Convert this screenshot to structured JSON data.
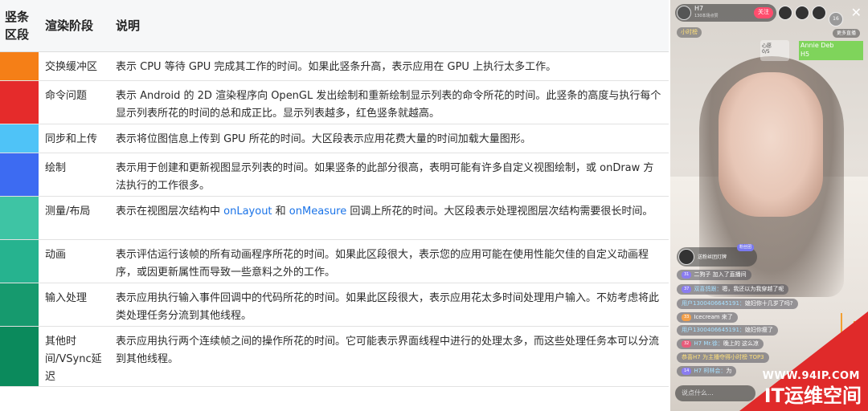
{
  "table": {
    "headers": [
      "竖条区段",
      "渲染阶段",
      "说明"
    ],
    "rows": [
      {
        "color": "#f57f17",
        "stage": "交换缓冲区",
        "desc": "表示 CPU 等待 GPU 完成其工作的时间。如果此竖条升高，表示应用在 GPU 上执行太多工作。"
      },
      {
        "color": "#e52b2b",
        "stage": "命令问题",
        "desc": "表示 Android 的 2D 渲染程序向 OpenGL 发出绘制和重新绘制显示列表的命令所花的时间。此竖条的高度与执行每个显示列表所花的时间的总和成正比。显示列表越多，红色竖条就越高。"
      },
      {
        "color": "#4fc3f7",
        "stage": "同步和上传",
        "desc": "表示将位图信息上传到 GPU 所花的时间。大区段表示应用花费大量的时间加载大量图形。"
      },
      {
        "color": "#3d6bf2",
        "stage": "绘制",
        "desc": "表示用于创建和更新视图显示列表的时间。如果竖条的此部分很高，表明可能有许多自定义视图绘制，或 onDraw 方法执行的工作很多。"
      },
      {
        "color": "#3ec4a4",
        "stage": "测量/布局",
        "desc_pre": "表示在视图层次结构中 ",
        "link1": "onLayout",
        "desc_mid": " 和 ",
        "link2": "onMeasure",
        "desc_post": " 回调上所花的时间。大区段表示处理视图层次结构需要很长时间。"
      },
      {
        "color": "#26b38f",
        "stage": "动画",
        "desc": "表示评估运行该帧的所有动画程序所花的时间。如果此区段很大，表示您的应用可能在使用性能欠佳的自定义动画程序，或因更新属性而导致一些意料之外的工作。"
      },
      {
        "color": "#169a6e",
        "stage": "输入处理",
        "desc": "表示应用执行输入事件回调中的代码所花的时间。如果此区段很大，表示应用花太多时间处理用户输入。不妨考虑将此类处理任务分流到其他线程。"
      },
      {
        "color": "#0b8a5c",
        "stage": "其他时间/VSync延迟",
        "desc": "表示应用执行两个连续帧之间的操作所花的时间。它可能表示界面线程中进行的处理太多，而这些处理任务本可以分流到其他线程。"
      }
    ]
  },
  "live": {
    "anchor_name": "H7",
    "anchor_sub": "130本场点赞",
    "follow_label": "关注",
    "viewer_count": "16",
    "close_glyph": "✕",
    "more_label": "更多直播",
    "hourly_label": "小时榜",
    "pk_box_line1": "心愿",
    "pk_box_line2": "0/5",
    "pk_name_1": "Annie Deb",
    "pk_name_2": "H5",
    "fan_text": "送粉丝团灯牌",
    "fan_badge": "粉丝团",
    "chat": [
      {
        "lv": "31",
        "user": "",
        "text": "二狗子 加入了直播间"
      },
      {
        "lv": "37",
        "user": "双喜鸽跟：",
        "text": "嗯，我还以为我穿越了呢"
      },
      {
        "lv": "",
        "user": "用户1300406645191：",
        "text": "媳妇你十几岁了吗?"
      },
      {
        "lv": "33",
        "user": "",
        "text": "Icecream 来了"
      },
      {
        "lv": "",
        "user": "用户1300406645191：",
        "text": "媳妇你瘦了"
      },
      {
        "lv": "32",
        "user": "H7 Mr.徐：",
        "text": "晚上的 这么凉"
      },
      {
        "lv": "",
        "user": "恭喜",
        "text": "H7 为主播夺得小时榜 TOP3"
      },
      {
        "lv": "14",
        "user": "H7 柯林会：",
        "text": "为"
      }
    ],
    "input_placeholder": "说点什么..."
  },
  "watermark": {
    "url": "WWW.94IP.COM",
    "brand": "IT运维空间"
  }
}
